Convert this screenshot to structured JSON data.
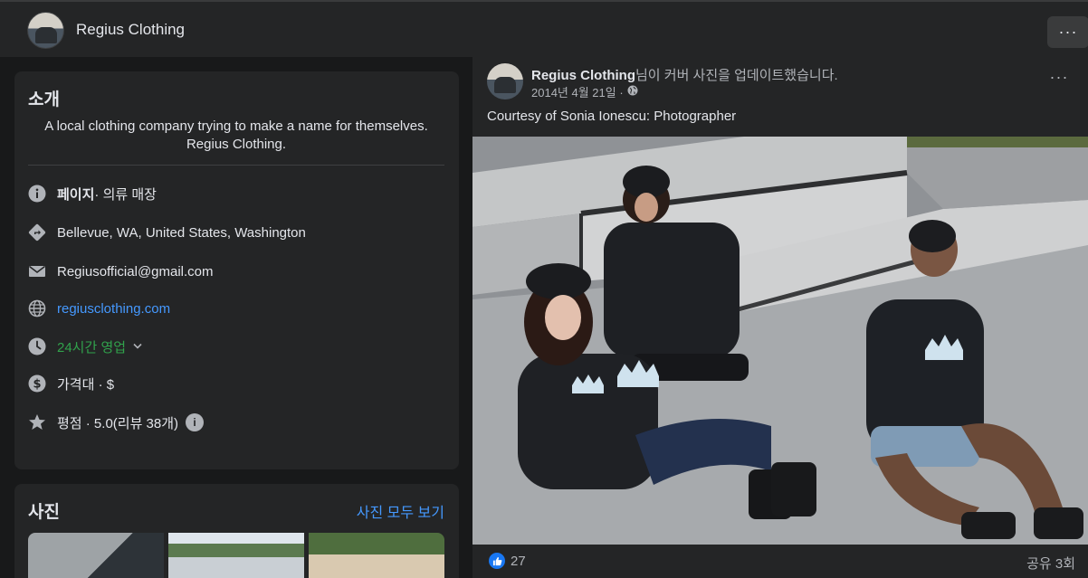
{
  "header": {
    "page_name": "Regius Clothing",
    "more_label": "···"
  },
  "intro": {
    "title": "소개",
    "bio_line1": "A local clothing company trying to make a name for themselves.",
    "bio_line2": "Regius Clothing.",
    "category_label": "페이지",
    "category_value": " · 의류 매장",
    "location": "Bellevue, WA, United States, Washington",
    "email": "Regiusofficial@gmail.com",
    "website": "regiusclothing.com",
    "hours": "24시간 영업",
    "price": "가격대 · $",
    "rating": "평점 · 5.0(리뷰 38개)"
  },
  "photos": {
    "title": "사진",
    "see_all": "사진 모두 보기"
  },
  "post": {
    "author": "Regius Clothing",
    "action": "님이 커버 사진을 업데이트했습니다.",
    "date": "2014년 4월 21일 ·",
    "more_label": "···",
    "caption": "Courtesy of Sonia Ionescu: Photographer",
    "like_count": "27",
    "share_count": "공유 3회"
  },
  "colors": {
    "background": "#18191a",
    "card": "#242526",
    "link": "#4599ff",
    "open_status": "#31a24c",
    "like_blue": "#1877f2"
  }
}
